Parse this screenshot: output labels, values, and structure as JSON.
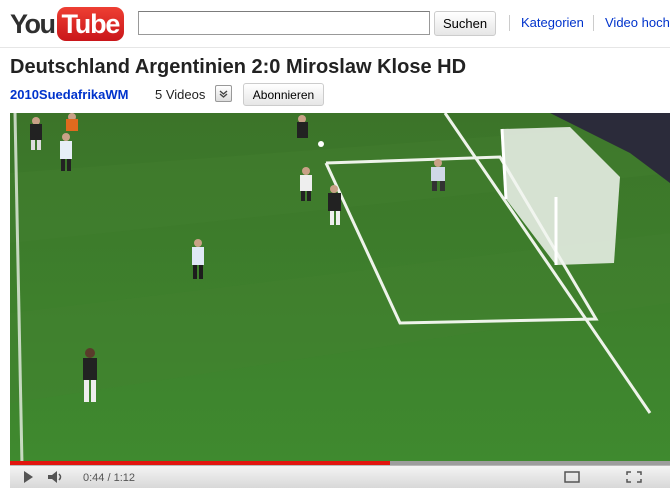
{
  "header": {
    "logo_you": "You",
    "logo_tube": "Tube",
    "search": {
      "value": "",
      "placeholder": ""
    },
    "search_button": "Suchen",
    "nav": {
      "categories": "Kategorien",
      "upload": "Video hoch"
    }
  },
  "video": {
    "title": "Deutschland Argentinien 2:0 Miroslaw Klose HD",
    "channel": "2010SuedafrikaWM",
    "videos_count": "5 Videos",
    "subscribe": "Abonnieren"
  },
  "player": {
    "time": "0:44 / 1:12",
    "progress": {
      "played": 0.575,
      "loaded": 1.0
    },
    "icons": [
      "play-icon",
      "volume-icon",
      "popout-icon",
      "fullscreen-icon"
    ]
  },
  "colors": {
    "brand_red": "#d7261f",
    "link_blue": "#0033cc",
    "pitch_green": "#3f7a2c"
  }
}
